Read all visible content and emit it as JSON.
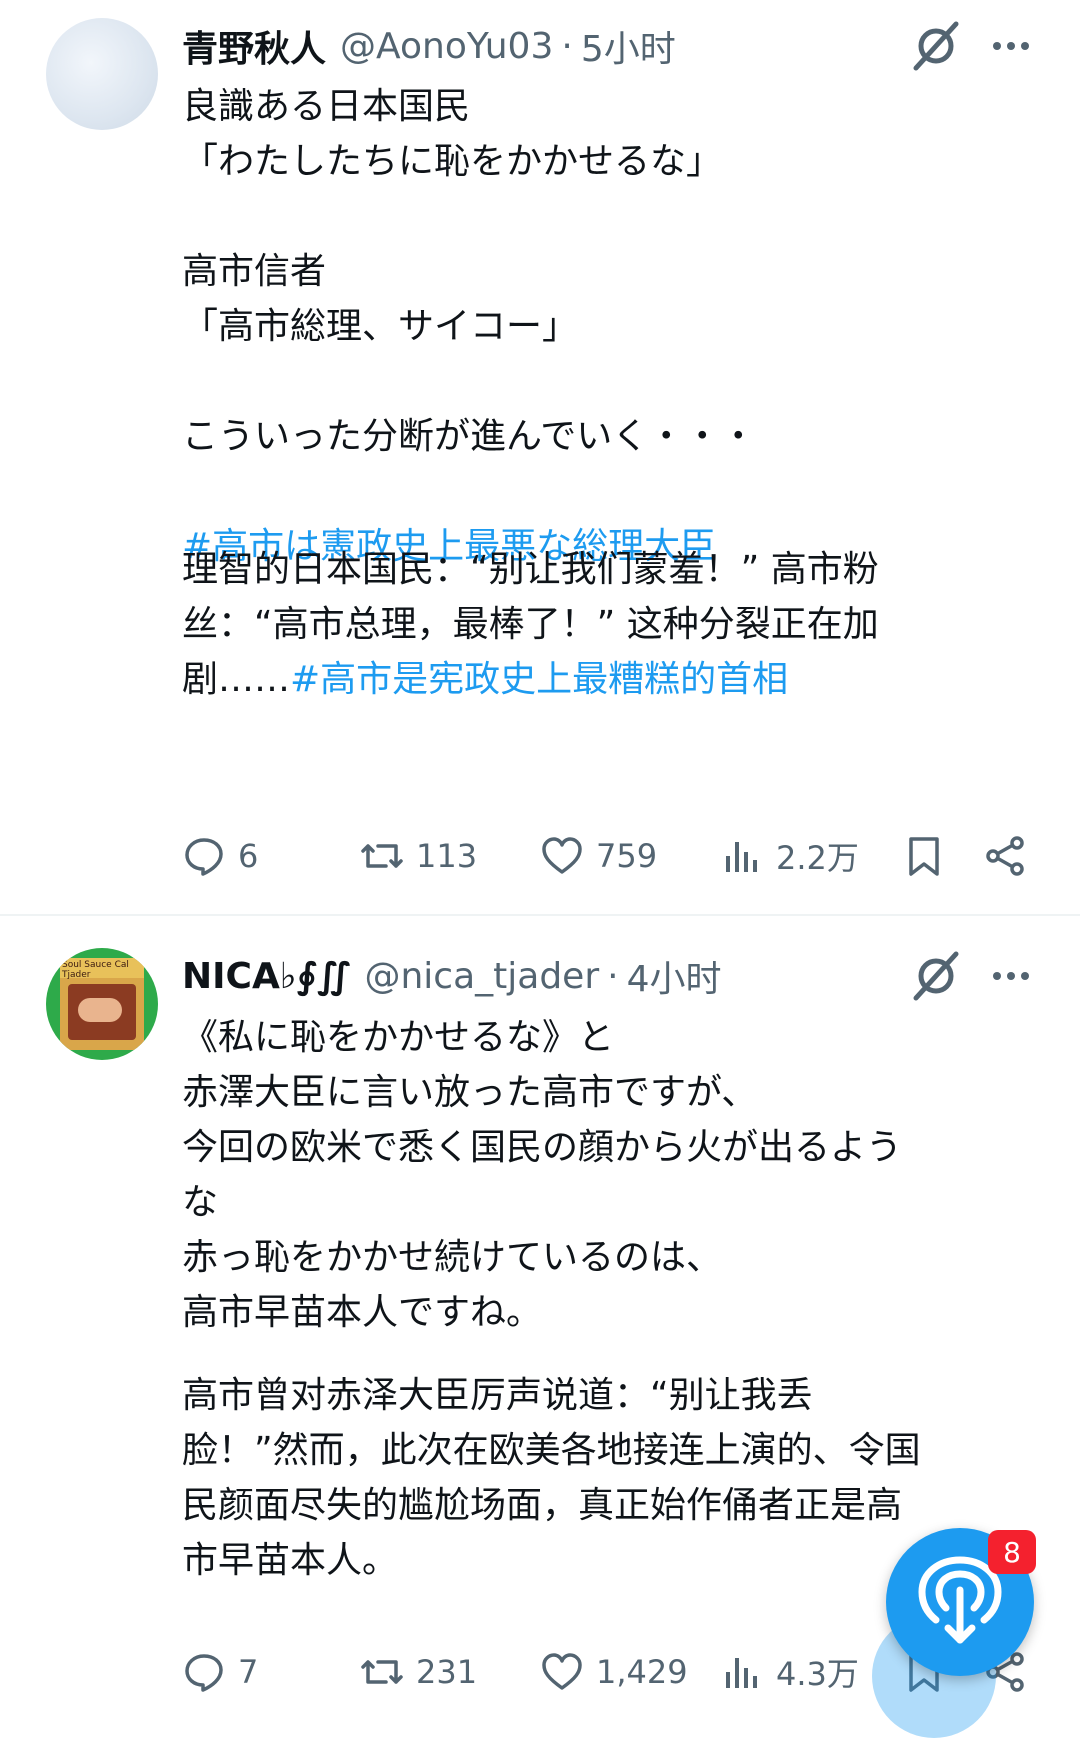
{
  "tweets": [
    {
      "author_name": "青野秋人",
      "handle": "@AonoYu03",
      "separator": "·",
      "time": "5小时",
      "body_lines": [
        "良識ある日本国民",
        "「わたしたちに恥をかかせるな」",
        "",
        "高市信者",
        "「高市総理、サイコー」",
        "",
        "こういった分断が進んでいく・・・",
        ""
      ],
      "hashtag": "#高市は憲政史上最悪な総理大臣",
      "translation_lines": [
        "理智的日本国民：“别让我们蒙羞！” 高市粉",
        "丝：“高市总理，最棒了！” 这种分裂正在加"
      ],
      "translation_last_prefix": "剧……",
      "translation_hashtag": "#高市是宪政史上最糟糕的首相",
      "replies": "6",
      "reposts": "113",
      "likes": "759",
      "views": "2.2万"
    },
    {
      "author_name": "NICA♭∮∬",
      "handle": "@nica_tjader",
      "separator": "·",
      "time": "4小时",
      "avatar_text": "Soul Sauce  Cal Tjader",
      "body_lines": [
        "《私に恥をかかせるな》と",
        "赤澤大臣に言い放った高市ですが、",
        "今回の欧米で悉く国民の顔から火が出るよう",
        "な",
        "赤っ恥をかかせ続けているのは、",
        "高市早苗本人ですね。"
      ],
      "translation_lines": [
        "高市曾对赤泽大臣厉声说道：“别让我丢",
        "脸！”然而，此次在欧美各地接连上演的、令国",
        "民颜面尽失的尴尬场面，真正始作俑者正是高",
        "市早苗本人。"
      ],
      "replies": "7",
      "reposts": "231",
      "likes": "1,429",
      "views": "4.3万"
    }
  ],
  "fab": {
    "badge": "8"
  },
  "colors": {
    "accent": "#1d9bf0",
    "text": "#0f1419",
    "muted": "#536471",
    "badge": "#f4212e"
  },
  "icons": [
    "grok-icon",
    "more-icon",
    "reply-icon",
    "repost-icon",
    "like-icon",
    "views-icon",
    "bookmark-icon",
    "share-icon",
    "spaces-icon"
  ]
}
